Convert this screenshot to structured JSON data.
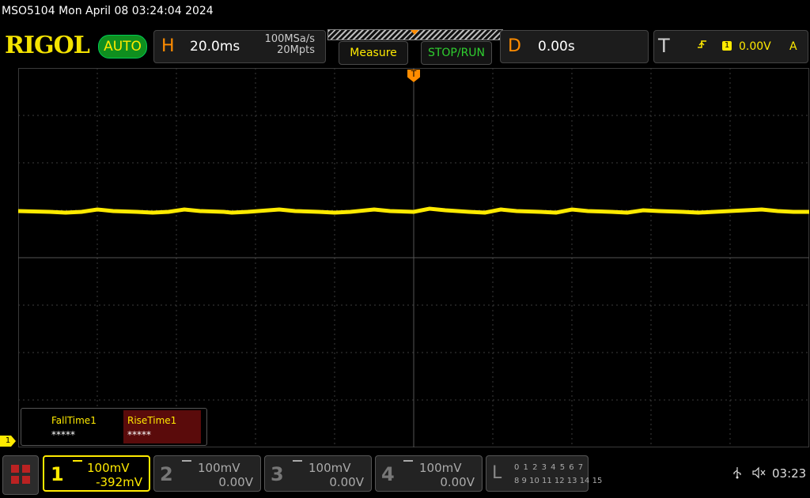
{
  "title": "MSO5104  Mon April 08 03:24:04 2024",
  "brand": "RIGOL",
  "mode_badge": "AUTO",
  "horizontal": {
    "letter": "H",
    "scale": "20.0ms",
    "sample_rate": "100MSa/s",
    "mem_depth": "20Mpts"
  },
  "buttons": {
    "measure": "Measure",
    "stop_run": "STOP/RUN"
  },
  "delay": {
    "letter": "D",
    "value": "0.00s"
  },
  "trigger": {
    "letter": "T",
    "source": "1",
    "level": "0.00V",
    "mode": "A",
    "marker": "T",
    "edge_icon": "rising-edge-icon"
  },
  "measurements": [
    {
      "name": "FallTime1",
      "value": "*****"
    },
    {
      "name": "RiseTime1",
      "value": "*****"
    }
  ],
  "ch1_ground_label": "1",
  "channels": [
    {
      "num": "1",
      "scale": "100mV",
      "offset": "-392mV",
      "active": true,
      "color": "#ffea00"
    },
    {
      "num": "2",
      "scale": "100mV",
      "offset": "0.00V",
      "active": false
    },
    {
      "num": "3",
      "scale": "100mV",
      "offset": "0.00V",
      "active": false
    },
    {
      "num": "4",
      "scale": "100mV",
      "offset": "0.00V",
      "active": false
    }
  ],
  "logic": {
    "letter": "L",
    "row1": "0 1 2 3  4 5 6 7",
    "row2": "8 9 10 11 12 13 14 15"
  },
  "status": {
    "clock": "03:23",
    "usb_icon": "usb-icon",
    "speaker_icon": "speaker-muted-icon"
  },
  "colors": {
    "trace": "#ffea00",
    "accent": "#ff8c00",
    "run": "#2fcf2f"
  }
}
